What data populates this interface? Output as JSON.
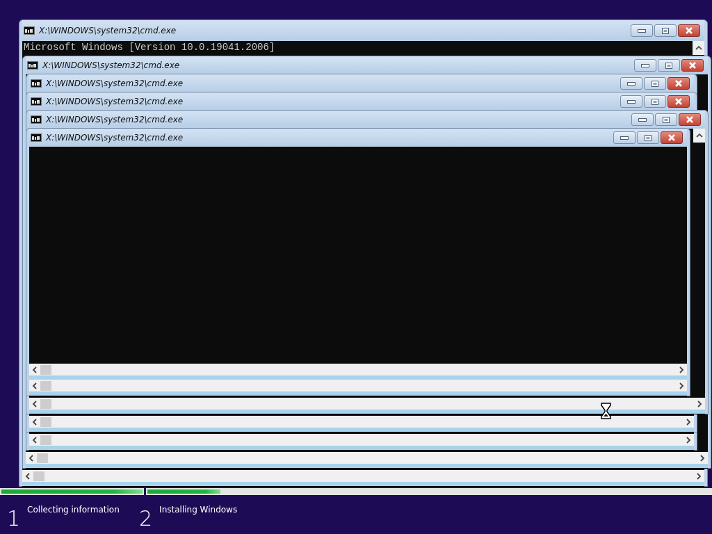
{
  "windows": [
    {
      "title": "X:\\WINDOWS\\system32\\cmd.exe",
      "console_lines": [
        "Microsoft Windows [Version 10.0.19041.2006]"
      ]
    },
    {
      "title": "X:\\WINDOWS\\system32\\cmd.exe"
    },
    {
      "title": "X:\\WINDOWS\\system32\\cmd.exe"
    },
    {
      "title": "X:\\WINDOWS\\system32\\cmd.exe"
    },
    {
      "title": "X:\\WINDOWS\\system32\\cmd.exe"
    },
    {
      "title": "X:\\WINDOWS\\system32\\cmd.exe"
    }
  ],
  "setup_progress": [
    {
      "level": 1
    },
    {
      "level": 0.13
    }
  ],
  "steps": [
    {
      "number": "1",
      "label": "Collecting information"
    },
    {
      "number": "2",
      "label": "Installing Windows"
    }
  ]
}
